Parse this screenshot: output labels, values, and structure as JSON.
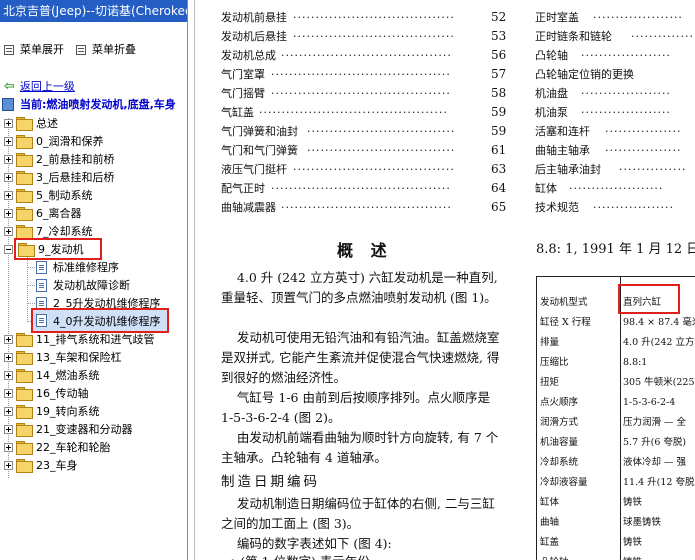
{
  "window": {
    "title": "北京吉普(Jeep)--切诺基(Cherokee)"
  },
  "toolbar": {
    "expand_label": "菜单展开",
    "collapse_label": "菜单折叠"
  },
  "nav": {
    "back_label": "返回上一级",
    "current_label": "当前:燃油喷射发动机,底盘,车身"
  },
  "tree": {
    "top_items": [
      {
        "label": "总述"
      },
      {
        "label": "0_润滑和保养"
      },
      {
        "label": "2_前悬挂和前桥"
      },
      {
        "label": "3_后悬挂和后桥"
      },
      {
        "label": "5_制动系统"
      },
      {
        "label": "6_离合器"
      },
      {
        "label": "7_冷却系统"
      },
      {
        "label": "9_发动机"
      }
    ],
    "engine_children": [
      {
        "label": "标准维修程序"
      },
      {
        "label": "发动机故障诊断"
      },
      {
        "label": "2_5升发动机维修程序"
      },
      {
        "label": "4_0升发动机维修程序"
      }
    ],
    "bottom_items": [
      {
        "label": "11_排气系统和进气歧管"
      },
      {
        "label": "13_车架和保险杠"
      },
      {
        "label": "14_燃油系统"
      },
      {
        "label": "16_传动轴"
      },
      {
        "label": "19_转向系统"
      },
      {
        "label": "21_变速器和分动器"
      },
      {
        "label": "22_车轮和轮胎"
      },
      {
        "label": "23_车身"
      }
    ]
  },
  "document": {
    "toc_left": [
      {
        "title": "发动机前悬挂",
        "page": "52"
      },
      {
        "title": "发动机后悬挂",
        "page": "53"
      },
      {
        "title": "发动机总成",
        "page": "56"
      },
      {
        "title": "气门室罩",
        "page": "57"
      },
      {
        "title": "气门摇臂",
        "page": "58"
      },
      {
        "title": "气缸盖",
        "page": "59"
      },
      {
        "title": "气门弹簧和油封",
        "page": "59"
      },
      {
        "title": "气门和气门弹簧",
        "page": "61"
      },
      {
        "title": "液压气门挺杆",
        "page": "63"
      },
      {
        "title": "配气正时",
        "page": "64"
      },
      {
        "title": "曲轴减震器",
        "page": "65"
      }
    ],
    "toc_right": [
      {
        "title": "正时室盖"
      },
      {
        "title": "正时链条和链轮"
      },
      {
        "title": "凸轮轴"
      },
      {
        "title": "凸轮轴定位销的更换"
      },
      {
        "title": "机油盘"
      },
      {
        "title": "机油泵"
      },
      {
        "title": "活塞和连杆"
      },
      {
        "title": "曲轴主轴承"
      },
      {
        "title": "后主轴承油封"
      },
      {
        "title": "缸体"
      },
      {
        "title": "技术规范"
      }
    ],
    "section_heading": "概  述",
    "right_header_line": "8.8: 1, 1991 年 1 月 12 日",
    "paragraphs": [
      "    4.0 升 (242 立方英寸) 六缸发动机是一种直列, 重量轻、顶置气门的多点燃油喷射发动机 (图 1)。",
      "    发动机可使用无铅汽油和有铅汽油。缸盖燃烧室是双拼式, 它能产生紊流并促使混合气快速燃烧, 得到很好的燃油经济性。",
      "    气缸号 1-6 由前到后按顺序排列。点火顺序是 1-5-3-6-2-4 (图 2)。",
      "    由发动机前端看曲轴为顺时针方向旋转, 有 7 个主轴承。凸轮轴有 4 道轴承。"
    ],
    "subheading": "制造日期编码",
    "paragraphs2": [
      "    发动机制造日期编码位于缸体的右侧, 二与三缸之间的加工面上 (图 3)。",
      "    编码的数字表述如下 (图 4):",
      "  • (第 1 位数字) 表示年份"
    ],
    "spec_table": [
      {
        "key": "发动机型式",
        "value": "直列六缸"
      },
      {
        "key": "缸径 X 行程",
        "value": "98.4 × 87.4 毫米"
      },
      {
        "key": "排量",
        "value": "4.0 升(242 立方英寸)"
      },
      {
        "key": "压缩比",
        "value": "8.8:1"
      },
      {
        "key": "扭矩",
        "value": "305 牛顿米(225"
      },
      {
        "key": "点火顺序",
        "value": "1-5-3-6-2-4"
      },
      {
        "key": "润滑方式",
        "value": "压力润滑 — 全"
      },
      {
        "key": "机油容量",
        "value": "5.7 升(6 夸脱)"
      },
      {
        "key": "冷却系统",
        "value": "液体冷却 — 强"
      },
      {
        "key": "冷却液容量",
        "value": "11.4 升(12 夸脱)"
      },
      {
        "key": "缸体",
        "value": "铸铁"
      },
      {
        "key": "曲轴",
        "value": "球墨铸铁"
      },
      {
        "key": "缸盖",
        "value": "铸铁"
      },
      {
        "key": "凸轮轴",
        "value": "铸铁"
      }
    ]
  },
  "colors": {
    "titlebar": "#245ec4",
    "link": "#0000cc",
    "highlight": "#e0201b",
    "folder": "#f5d469"
  }
}
